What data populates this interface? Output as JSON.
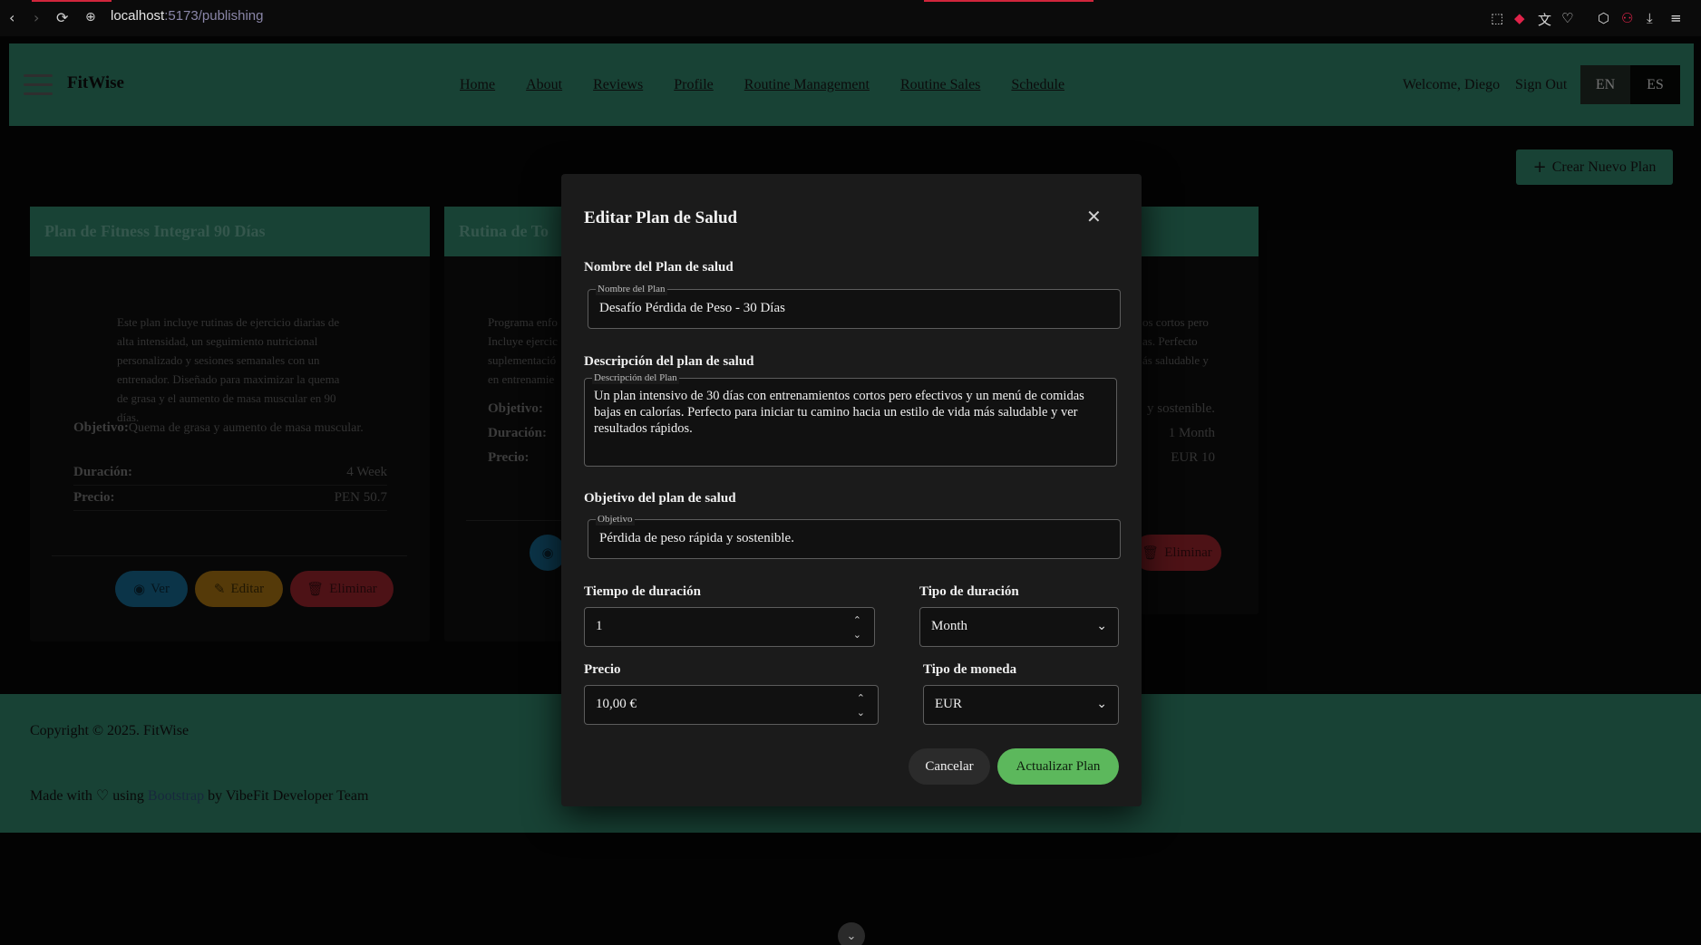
{
  "browser": {
    "url_host": "localhost",
    "url_rest": ":5173/publishing"
  },
  "navbar": {
    "brand": "FitWise",
    "links": [
      "Home",
      "About",
      "Reviews",
      "Profile",
      "Routine Management",
      "Routine Sales",
      "Schedule"
    ],
    "welcome": "Welcome, Diego",
    "sign_out": "Sign Out",
    "lang_en": "EN",
    "lang_es": "ES"
  },
  "create_button": "Crear Nuevo Plan",
  "cards": [
    {
      "title": "Plan de Fitness Integral 90 Días",
      "description": "Este plan incluye rutinas de ejercicio diarias de alta intensidad, un seguimiento nutricional personalizado y sesiones semanales con un entrenador. Diseñado para maximizar la quema de grasa y el aumento de masa muscular en 90 días.",
      "objective_label": "Objetivo:",
      "objective": "Quema de grasa y aumento de masa muscular.",
      "duration_label": "Duración:",
      "duration": "4 Week",
      "price_label": "Precio:",
      "price": "PEN 50.7",
      "view": "Ver",
      "edit": "Editar",
      "delete": "Eliminar"
    },
    {
      "title": "Rutina de To",
      "desc_lines": [
        "Programa enfo",
        "Incluye ejercic",
        "suplementació",
        "en entrenamie"
      ],
      "objective_label": "Objetivo:",
      "duration_label": "Duración:",
      "price_label": "Precio:"
    },
    {
      "desc_lines": [
        "os cortos pero",
        "as. Perfecto",
        "ás saludable y"
      ],
      "objective": "y sostenible.",
      "duration": "1 Month",
      "price": "EUR 10",
      "delete": "Eliminar"
    }
  ],
  "footer": {
    "copyright": "Copyright © 2025. FitWise",
    "made_prefix": "Made with",
    "made_using": "using",
    "made_link": "Bootstrap",
    "made_suffix": "by VibeFit Developer Team"
  },
  "modal": {
    "title": "Editar Plan de Salud",
    "name_section": "Nombre del Plan de salud",
    "name_legend": "Nombre del Plan",
    "name_value": "Desafío Pérdida de Peso - 30 Días",
    "desc_section": "Descripción del plan de salud",
    "desc_legend": "Descripción del Plan",
    "desc_value": "Un plan intensivo de 30 días con entrenamientos cortos pero efectivos y un menú de comidas bajas en calorías. Perfecto para iniciar tu camino hacia un estilo de vida más saludable y ver resultados rápidos.",
    "objective_section": "Objetivo del plan de salud",
    "objective_legend": "Objetivo",
    "objective_value": "Pérdida de peso rápida y sostenible.",
    "duration_time_label": "Tiempo de duración",
    "duration_time_value": "1",
    "duration_type_label": "Tipo de duración",
    "duration_type_value": "Month",
    "price_label": "Precio",
    "price_value": "10,00 €",
    "currency_label": "Tipo de moneda",
    "currency_value": "EUR",
    "cancel": "Cancelar",
    "update": "Actualizar Plan"
  },
  "colors": {
    "brand_green": "#2d7862",
    "update_green": "#5cb85c",
    "view_blue": "#1a7fb0",
    "edit_orange": "#c98a17",
    "delete_red": "#b52b34"
  }
}
